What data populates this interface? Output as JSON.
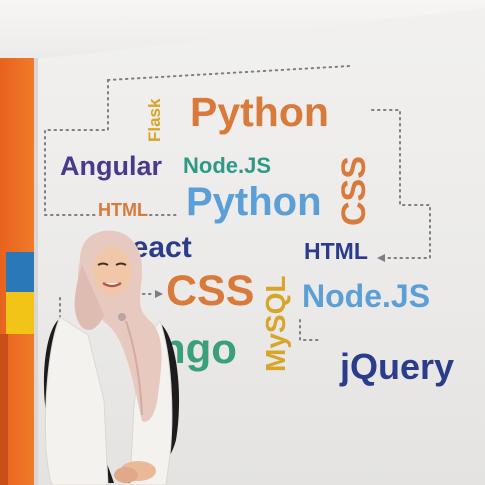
{
  "words": [
    {
      "id": "python-1",
      "text": "Python"
    },
    {
      "id": "flask",
      "text": "Flask"
    },
    {
      "id": "angular",
      "text": "Angular"
    },
    {
      "id": "nodejs-1",
      "text": "Node.JS"
    },
    {
      "id": "css-vertical",
      "text": "CSS"
    },
    {
      "id": "html-1",
      "text": "HTML"
    },
    {
      "id": "python-2",
      "text": "Python"
    },
    {
      "id": "react",
      "text": "React"
    },
    {
      "id": "mysql",
      "text": "MySQL"
    },
    {
      "id": "html-2",
      "text": "HTML"
    },
    {
      "id": "css-2",
      "text": "CSS"
    },
    {
      "id": "nodejs-2",
      "text": "Node.JS"
    },
    {
      "id": "ngo",
      "text": "ngo"
    },
    {
      "id": "jquery",
      "text": "jQuery"
    }
  ],
  "colors": {
    "orange": "#d9793a",
    "purple": "#4a3a8c",
    "teal": "#2e9a86",
    "blue": "#5b9fd6",
    "gold": "#d8a52a",
    "navy": "#2a3c8a",
    "green": "#3aa07a",
    "wall_stripe_orange": "#e8621e",
    "wall_stripe_blue": "#2a78b8",
    "wall_stripe_yellow": "#f2c417",
    "hijab": "#e8c9bf",
    "vest": "#f4f2ee",
    "shirt": "#1c1c1e"
  }
}
